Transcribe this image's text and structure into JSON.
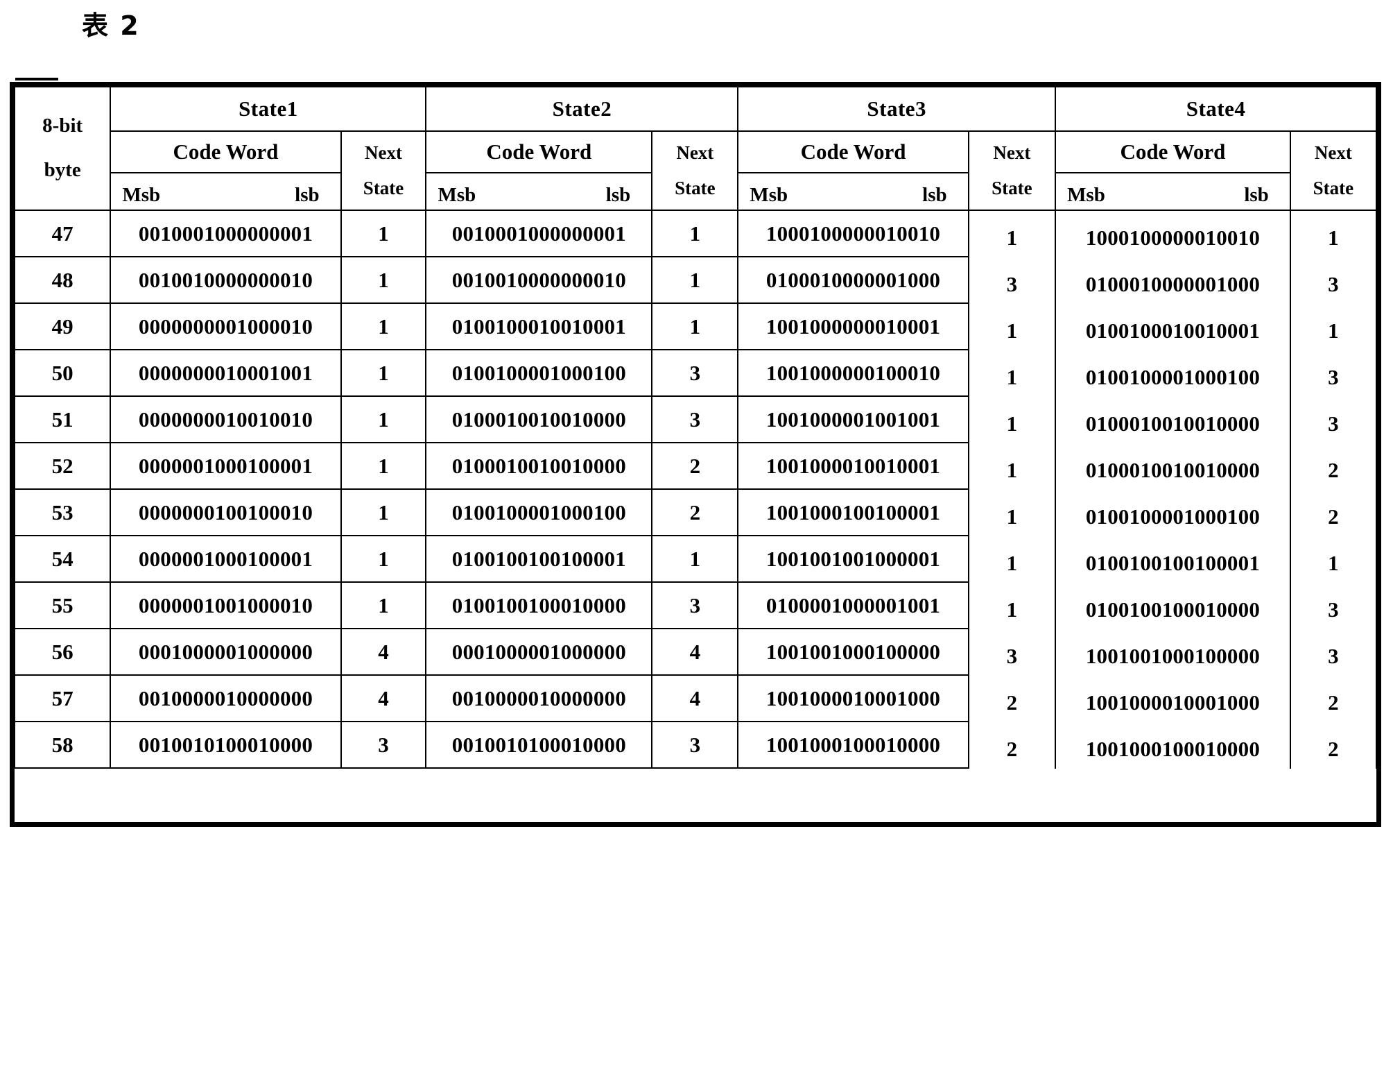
{
  "caption": "表 2",
  "table": {
    "row_header_label_line1": "8-bit",
    "row_header_label_line2": "byte",
    "state_groups": [
      {
        "name": "State1",
        "code_word_label": "Code Word",
        "msb_label": "Msb",
        "lsb_label": "lsb",
        "next_label_line1": "Next",
        "next_label_line2": "State"
      },
      {
        "name": "State2",
        "code_word_label": "Code Word",
        "msb_label": "Msb",
        "lsb_label": "lsb",
        "next_label_line1": "Next",
        "next_label_line2": "State"
      },
      {
        "name": "State3",
        "code_word_label": "Code Word",
        "msb_label": "Msb",
        "lsb_label": "lsb",
        "next_label_line1": "Next",
        "next_label_line2": "State"
      },
      {
        "name": "State4",
        "code_word_label": "Code Word",
        "msb_label": "Msb",
        "lsb_label": "lsb",
        "next_label_line1": "Next",
        "next_label_line2": "State"
      }
    ],
    "rows": [
      {
        "byte": "47",
        "s1_cw": "0010001000000001",
        "s1_ns": "1",
        "s2_cw": "0010001000000001",
        "s2_ns": "1",
        "s3_cw": "1000100000010010",
        "s3_ns": "1",
        "s4_cw": "1000100000010010",
        "s4_ns": "1"
      },
      {
        "byte": "48",
        "s1_cw": "0010010000000010",
        "s1_ns": "1",
        "s2_cw": "0010010000000010",
        "s2_ns": "1",
        "s3_cw": "0100010000001000",
        "s3_ns": "3",
        "s4_cw": "0100010000001000",
        "s4_ns": "3"
      },
      {
        "byte": "49",
        "s1_cw": "0000000001000010",
        "s1_ns": "1",
        "s2_cw": "0100100010010001",
        "s2_ns": "1",
        "s3_cw": "1001000000010001",
        "s3_ns": "1",
        "s4_cw": "0100100010010001",
        "s4_ns": "1"
      },
      {
        "byte": "50",
        "s1_cw": "0000000010001001",
        "s1_ns": "1",
        "s2_cw": "0100100001000100",
        "s2_ns": "3",
        "s3_cw": "1001000000100010",
        "s3_ns": "1",
        "s4_cw": "0100100001000100",
        "s4_ns": "3"
      },
      {
        "byte": "51",
        "s1_cw": "0000000010010010",
        "s1_ns": "1",
        "s2_cw": "0100010010010000",
        "s2_ns": "3",
        "s3_cw": "1001000001001001",
        "s3_ns": "1",
        "s4_cw": "0100010010010000",
        "s4_ns": "3"
      },
      {
        "byte": "52",
        "s1_cw": "0000001000100001",
        "s1_ns": "1",
        "s2_cw": "0100010010010000",
        "s2_ns": "2",
        "s3_cw": "1001000010010001",
        "s3_ns": "1",
        "s4_cw": "0100010010010000",
        "s4_ns": "2"
      },
      {
        "byte": "53",
        "s1_cw": "0000000100100010",
        "s1_ns": "1",
        "s2_cw": "0100100001000100",
        "s2_ns": "2",
        "s3_cw": "1001000100100001",
        "s3_ns": "1",
        "s4_cw": "0100100001000100",
        "s4_ns": "2"
      },
      {
        "byte": "54",
        "s1_cw": "0000001000100001",
        "s1_ns": "1",
        "s2_cw": "0100100100100001",
        "s2_ns": "1",
        "s3_cw": "1001001001000001",
        "s3_ns": "1",
        "s4_cw": "0100100100100001",
        "s4_ns": "1"
      },
      {
        "byte": "55",
        "s1_cw": "0000001001000010",
        "s1_ns": "1",
        "s2_cw": "0100100100010000",
        "s2_ns": "3",
        "s3_cw": "0100001000001001",
        "s3_ns": "1",
        "s4_cw": "0100100100010000",
        "s4_ns": "3"
      },
      {
        "byte": "56",
        "s1_cw": "0001000001000000",
        "s1_ns": "4",
        "s2_cw": "0001000001000000",
        "s2_ns": "4",
        "s3_cw": "1001001000100000",
        "s3_ns": "3",
        "s4_cw": "1001001000100000",
        "s4_ns": "3"
      },
      {
        "byte": "57",
        "s1_cw": "0010000010000000",
        "s1_ns": "4",
        "s2_cw": "0010000010000000",
        "s2_ns": "4",
        "s3_cw": "1001000010001000",
        "s3_ns": "2",
        "s4_cw": "1001000010001000",
        "s4_ns": "2"
      },
      {
        "byte": "58",
        "s1_cw": "0010010100010000",
        "s1_ns": "3",
        "s2_cw": "0010010100010000",
        "s2_ns": "3",
        "s3_cw": "1001000100010000",
        "s3_ns": "2",
        "s4_cw": "1001000100010000",
        "s4_ns": "2"
      }
    ]
  }
}
